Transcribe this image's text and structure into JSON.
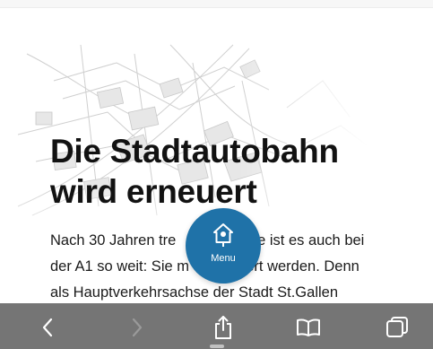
{
  "article": {
    "title_line1": "Die Stadtautobahn",
    "title_line2": "wird erneuert",
    "lead_line1": "Nach 30 Jahren tre                 ste ist es auch bei",
    "lead_line2": "der A1 so weit: Sie m             iert werden. Denn",
    "lead_line3": "als Hauptverkehrsachse der Stadt St.Gallen"
  },
  "fab": {
    "label": "Menu",
    "icon": "birdhouse-icon",
    "color": "#1f72a8"
  },
  "toolbar": {
    "back_icon": "chevron-left-icon",
    "forward_icon": "chevron-right-icon",
    "share_icon": "share-icon",
    "bookmarks_icon": "book-icon",
    "tabs_icon": "tabs-icon",
    "forward_disabled": true
  }
}
